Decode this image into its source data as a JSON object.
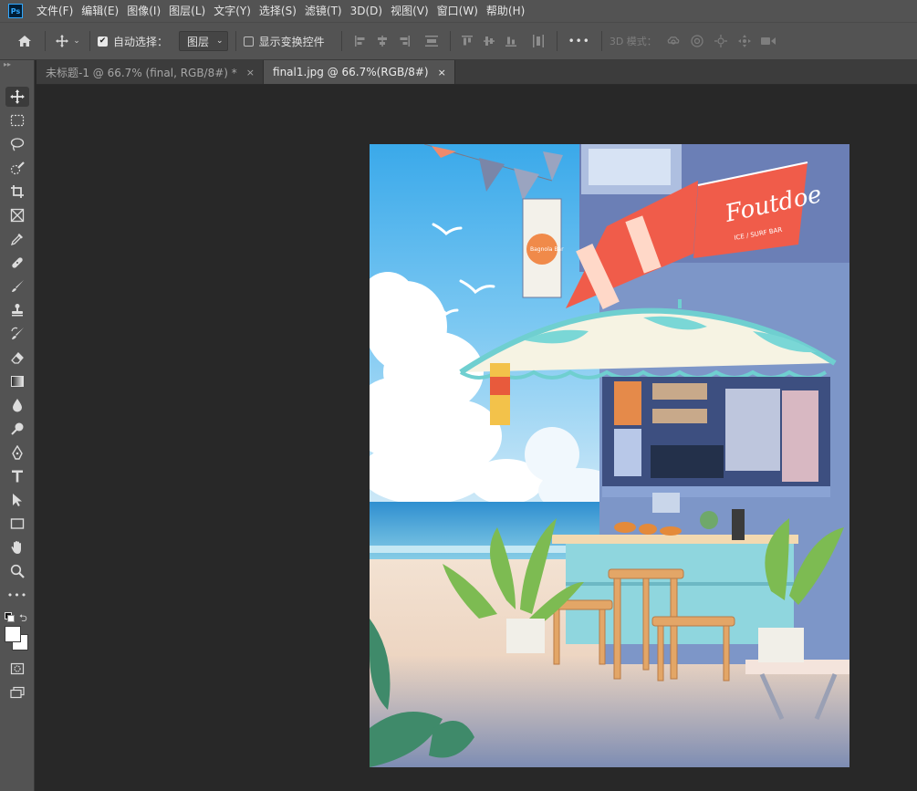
{
  "app": {
    "logo": "Ps"
  },
  "menu": [
    "文件(F)",
    "编辑(E)",
    "图像(I)",
    "图层(L)",
    "文字(Y)",
    "选择(S)",
    "滤镜(T)",
    "3D(D)",
    "视图(V)",
    "窗口(W)",
    "帮助(H)"
  ],
  "options": {
    "auto_select_label": "自动选择：",
    "auto_select_checked": "✔",
    "layer_select_value": "图层",
    "show_transform_label": "显示变换控件",
    "more_label": "•••",
    "mode_3d_label": "3D 模式："
  },
  "tabs": [
    {
      "label": "未标题-1 @ 66.7% (final, RGB/8#) *",
      "close": "×"
    },
    {
      "label": "final1.jpg @ 66.7%(RGB/8#)",
      "close": "×"
    }
  ],
  "toolbar": {
    "collapse": "▸▸",
    "more": "•••"
  },
  "image": {
    "sign_left": "Bagnola Bar",
    "sign_awning": "Foutdoe",
    "sign_awning_sub": "ICE / SURF BAR"
  },
  "colors": {
    "accent": "#31a8ff",
    "panel": "#535353",
    "canvas_bg": "#282828"
  }
}
